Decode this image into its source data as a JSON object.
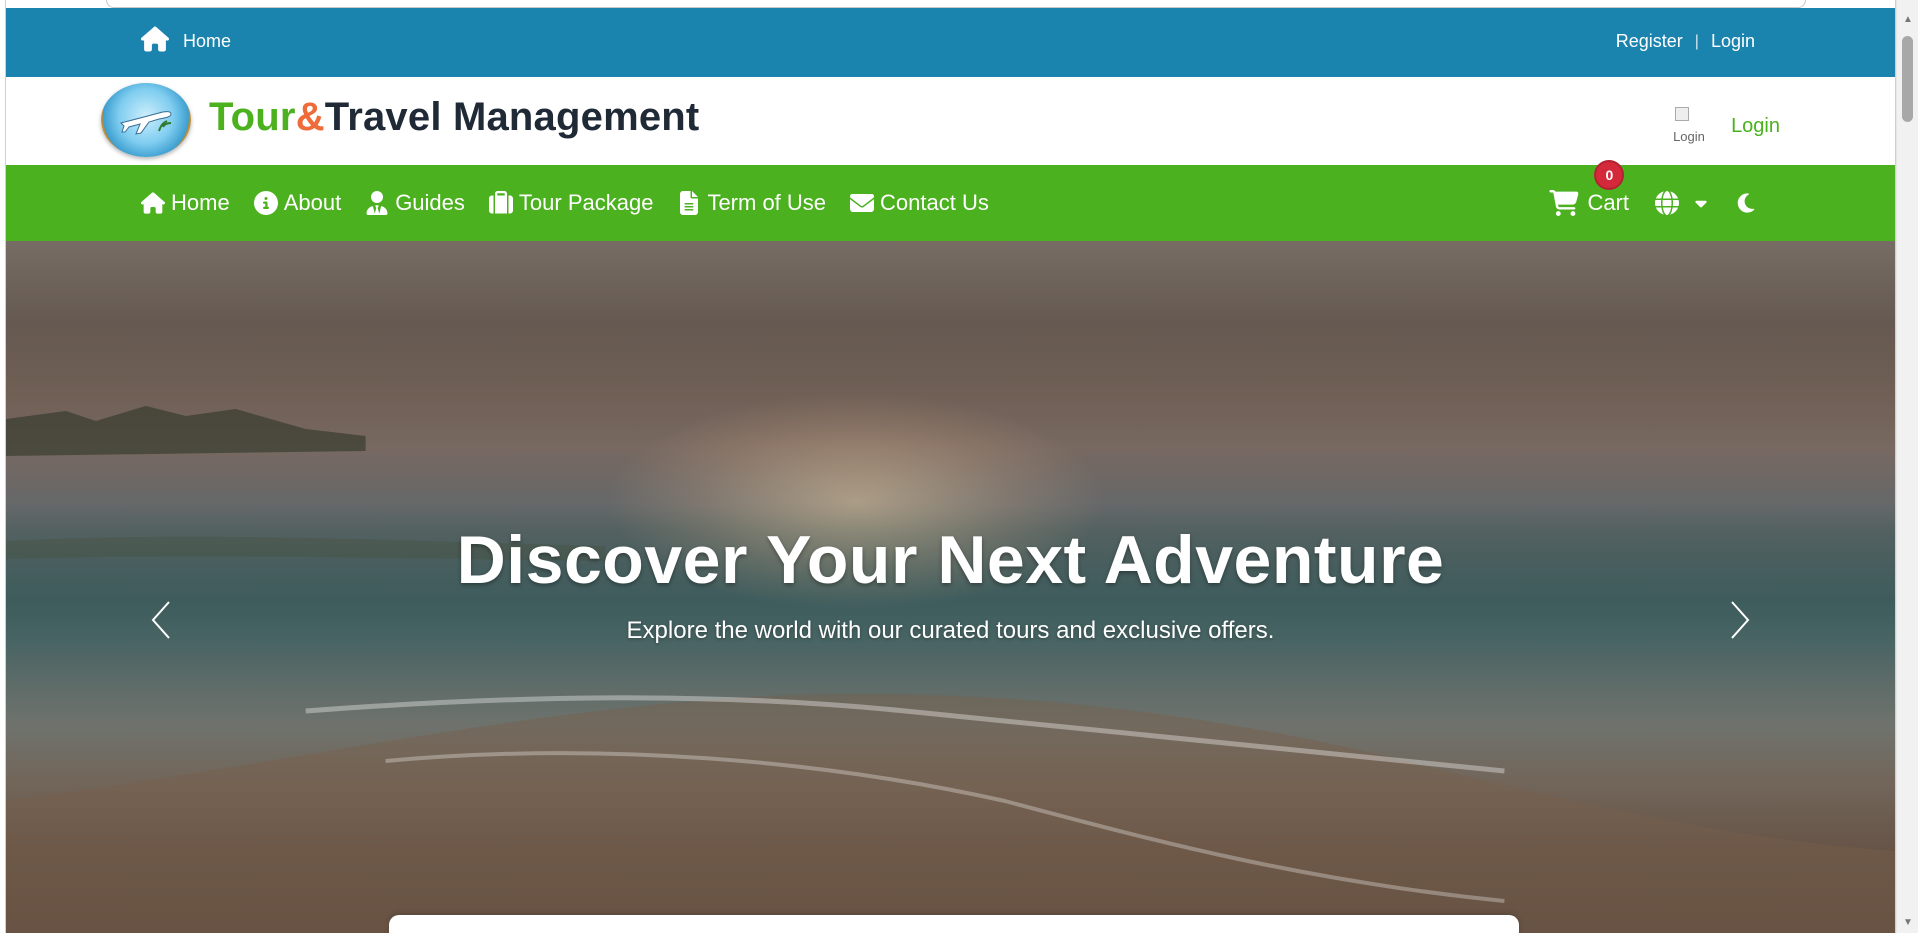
{
  "topbar": {
    "home_label": "Home",
    "register_label": "Register",
    "separator": "|",
    "login_label": "Login"
  },
  "brand": {
    "title_part1": "Tour",
    "title_part2": "&",
    "title_part3": "Travel Management",
    "login_img_alt": "Login",
    "login_label": "Login"
  },
  "nav": {
    "items": [
      {
        "label": "Home",
        "icon": "home-icon"
      },
      {
        "label": "About",
        "icon": "info-icon"
      },
      {
        "label": "Guides",
        "icon": "user-tie-icon"
      },
      {
        "label": "Tour Package",
        "icon": "suitcase-icon"
      },
      {
        "label": "Term of Use",
        "icon": "file-icon"
      },
      {
        "label": "Contact Us",
        "icon": "envelope-icon"
      }
    ],
    "cart_label": "Cart",
    "cart_count": "0",
    "language_icon": "globe-icon",
    "theme_icon": "moon-icon"
  },
  "hero": {
    "title": "Discover Your Next Adventure",
    "subtitle": "Explore the world with our curated tours and exclusive offers."
  },
  "colors": {
    "topbar": "#1b84ae",
    "nav": "#4bb11e",
    "accent_green": "#4bb11e",
    "accent_orange": "#ef6b3a",
    "badge": "#d4283b"
  }
}
